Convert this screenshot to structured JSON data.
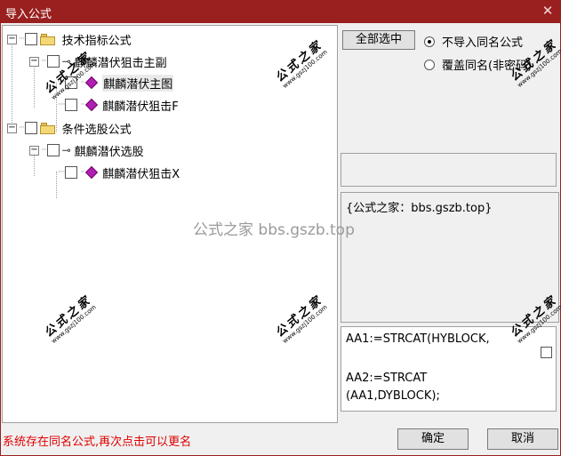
{
  "window": {
    "title": "导入公式",
    "close_glyph": "✕"
  },
  "tree": {
    "groups": [
      {
        "label": "技术指标公式",
        "expander": "−",
        "children": [
          {
            "label": "麒麟潜伏狙击主副",
            "icon": "key-icon",
            "expander": "−",
            "children": [
              {
                "label": "麒麟潜伏主图",
                "icon": "gem-icon",
                "selected": true
              },
              {
                "label": "麒麟潜伏狙击F",
                "icon": "gem-icon"
              }
            ]
          }
        ]
      },
      {
        "label": "条件选股公式",
        "expander": "−",
        "children": [
          {
            "label": "麒麟潜伏选股",
            "icon": "key-icon",
            "expander": "−",
            "children": [
              {
                "label": "麒麟潜伏狙击X",
                "icon": "gem-icon"
              }
            ]
          }
        ]
      }
    ]
  },
  "options": {
    "select_all_label": "全部选中",
    "radio_no_import_label": "不导入同名公式",
    "radio_overwrite_label": "覆盖同名(非密码)",
    "selected_radio": "no_import"
  },
  "description": {
    "text": "{公式之家：bbs.gszb.top}"
  },
  "code": {
    "lines": [
      "AA1:=STRCAT(HYBLOCK,",
      "",
      "AA2:=STRCAT",
      "(AA1,DYBLOCK);"
    ]
  },
  "status": {
    "message": "系统存在同名公式,再次点击可以更名",
    "color": "#e00000"
  },
  "buttons": {
    "ok_label": "确定",
    "cancel_label": "取消"
  },
  "watermark": {
    "cn": "公式之家",
    "url": "www.gszj100.com",
    "center": "公式之家 bbs.gszb.top"
  },
  "colors": {
    "titlebar": "#9a2020",
    "status_text": "#e00000",
    "gem": "#b020b0",
    "folder": "#f4d878"
  }
}
